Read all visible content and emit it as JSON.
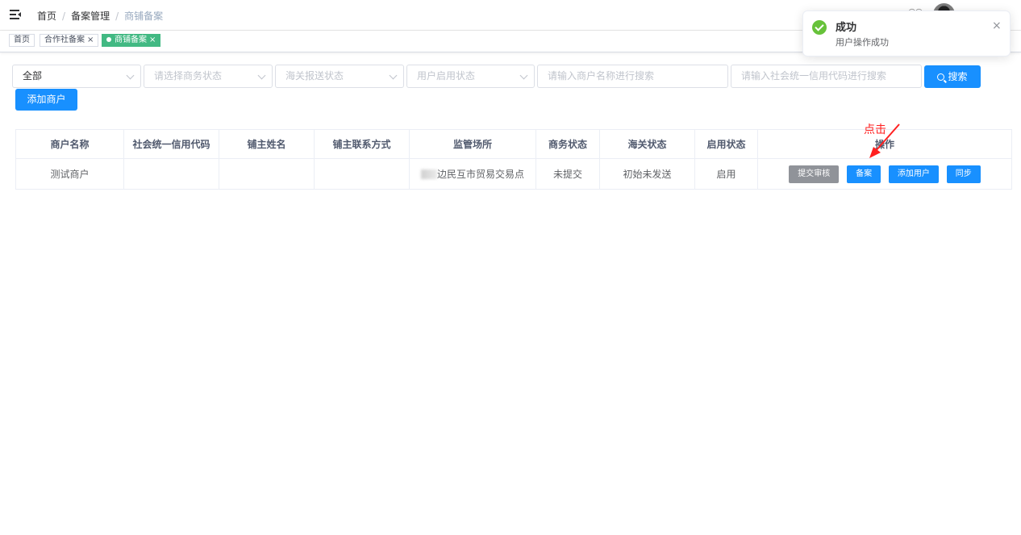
{
  "breadcrumb": [
    "首页",
    "备案管理",
    "商铺备案"
  ],
  "tags": [
    {
      "label": "首页"
    },
    {
      "label": "合作社备案",
      "close": "×"
    },
    {
      "label": "商铺备案",
      "close": "×"
    }
  ],
  "filters": {
    "scope": "全部",
    "business_status_placeholder": "请选择商务状态",
    "customs_status_placeholder": "海关报送状态",
    "user_status_placeholder": "用户启用状态",
    "merchant_name_placeholder": "请输入商户名称进行搜索",
    "credit_code_placeholder": "请输入社会统一信用代码进行搜索"
  },
  "buttons": {
    "search": "搜索",
    "add_merchant": "添加商户"
  },
  "table": {
    "headers": [
      "商户名称",
      "社会统一信用代码",
      "铺主姓名",
      "铺主联系方式",
      "监管场所",
      "商务状态",
      "海关状态",
      "启用状态",
      "操作"
    ],
    "rows": [
      {
        "merchant_name": "测试商户",
        "credit_code": "",
        "owner_name": "",
        "owner_contact": "",
        "site": "边民互市贸易交易点",
        "business_status": "未提交",
        "customs_status": "初始未发送",
        "enabled_status": "启用",
        "actions": [
          "提交审核",
          "备案",
          "添加用户",
          "同步"
        ]
      }
    ]
  },
  "annotation": {
    "text": "点击",
    "color": "#ff2020"
  },
  "toast": {
    "title": "成功",
    "message": "用户操作成功",
    "close": "×"
  },
  "colors": {
    "primary": "#1890ff",
    "tag_active": "#42b983",
    "success": "#67c23a",
    "gray_button": "#909399"
  }
}
